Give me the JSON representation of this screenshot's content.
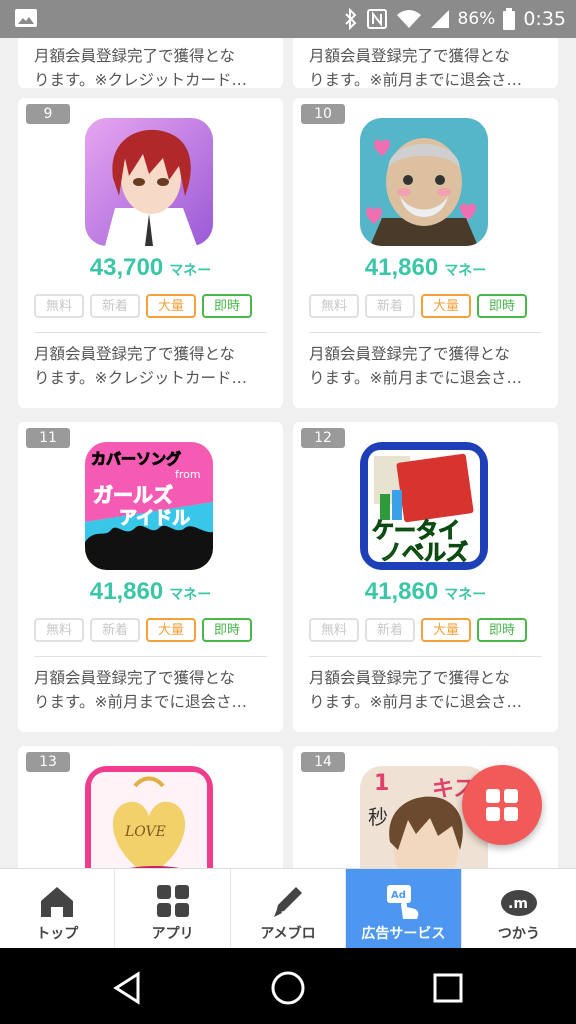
{
  "status_bar": {
    "battery": "86%",
    "time": "0:35",
    "icons": [
      "image-icon",
      "bluetooth-icon",
      "nfc-icon",
      "wifi-icon",
      "signal-icon",
      "battery-icon"
    ]
  },
  "top_strip": [
    {
      "desc_line1": "月額会員登録完了で獲得とな",
      "desc_line2": "ります。※クレジットカード…"
    },
    {
      "desc_line1": "月額会員登録完了で獲得とな",
      "desc_line2": "ります。※前月までに退会さ…"
    }
  ],
  "cards": [
    {
      "rank": "9",
      "amount": "43,700",
      "unit": "マネー",
      "tags": [
        "無料",
        "新着",
        "大量",
        "即時"
      ],
      "desc_line1": "月額会員登録完了で獲得とな",
      "desc_line2": "ります。※クレジットカード…",
      "icon": "anime-boy-red-hair-icon"
    },
    {
      "rank": "10",
      "amount": "41,860",
      "unit": "マネー",
      "tags": [
        "無料",
        "新着",
        "大量",
        "即時"
      ],
      "desc_line1": "月額会員登録完了で獲得とな",
      "desc_line2": "ります。※前月までに退会さ…",
      "icon": "old-man-hearts-icon"
    },
    {
      "rank": "11",
      "amount": "41,860",
      "unit": "マネー",
      "tags": [
        "無料",
        "新着",
        "大量",
        "即時"
      ],
      "desc_line1": "月額会員登録完了で獲得とな",
      "desc_line2": "ります。※前月までに退会さ…",
      "icon": "cover-song-girls-idol-icon",
      "icon_text": {
        "line1": "カバーソング",
        "from": "from",
        "line2": "ガールズ",
        "line3": "アイドル"
      }
    },
    {
      "rank": "12",
      "amount": "41,860",
      "unit": "マネー",
      "tags": [
        "無料",
        "新着",
        "大量",
        "即時"
      ],
      "desc_line1": "月額会員登録完了で獲得とな",
      "desc_line2": "ります。※前月までに退会さ…",
      "icon": "keitai-novels-icon",
      "icon_text": {
        "line1": "ケータイ",
        "line2": "ノベルズ"
      }
    },
    {
      "rank": "13",
      "icon": "love-heart-icon",
      "icon_text": {
        "line1": "LOVE"
      }
    },
    {
      "rank": "14",
      "icon": "kiss-boy-icon",
      "icon_text": {
        "line1": "キス",
        "num": "1",
        "sec": "秒"
      }
    }
  ],
  "tabbar": [
    {
      "label": "トップ",
      "icon": "home-icon",
      "active": false
    },
    {
      "label": "アプリ",
      "icon": "grid-icon",
      "active": false
    },
    {
      "label": "アメブロ",
      "icon": "pencil-icon",
      "active": false
    },
    {
      "label": "広告サービス",
      "icon": "ad-tap-icon",
      "active": true
    },
    {
      "label": "つかう",
      "icon": "money-icon",
      "active": false
    }
  ],
  "colors": {
    "reward": "#3cc6a8",
    "bulk_tag": "#f3a23b",
    "instant_tag": "#49b749",
    "fab": "#f25a5a",
    "active_tab": "#4d97f0"
  }
}
